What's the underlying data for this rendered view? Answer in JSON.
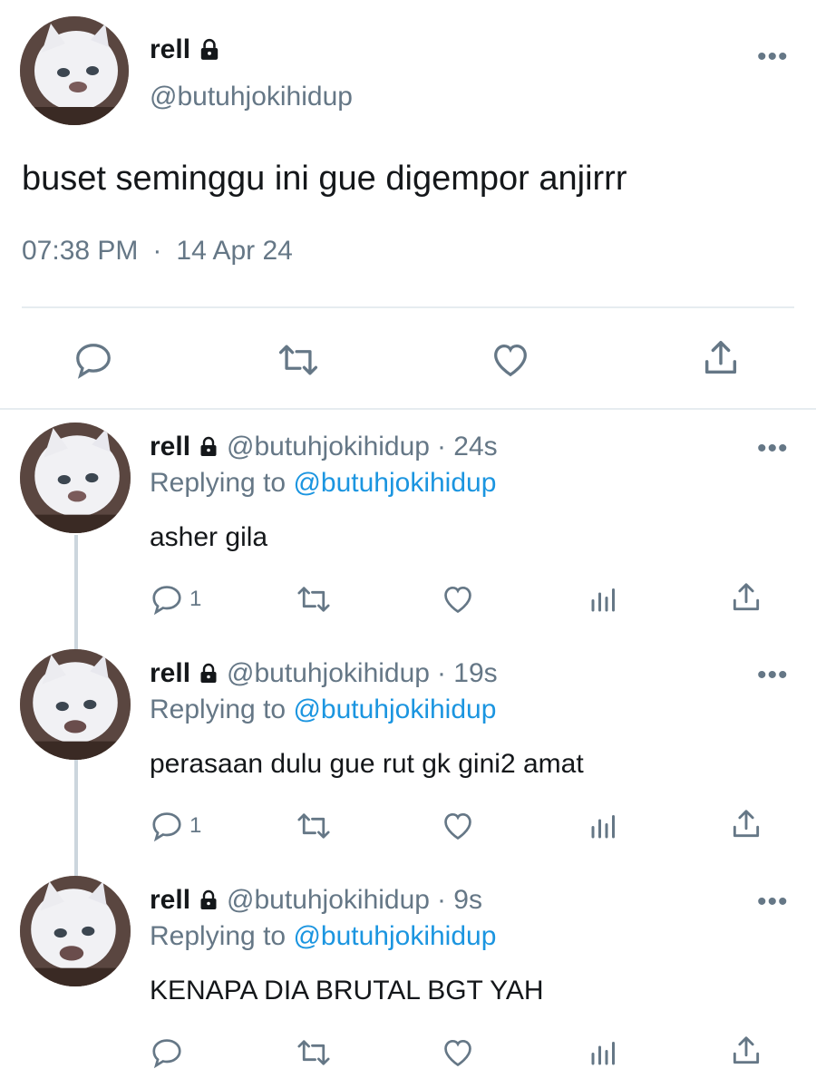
{
  "main_tweet": {
    "name": "rell",
    "handle": "@butuhjokihidup",
    "text": "buset seminggu ini gue digempor anjirrr",
    "time": "07:38 PM",
    "separator": "·",
    "date": "14 Apr 24",
    "more": "•••",
    "lock_icon": "lock-icon"
  },
  "replies": [
    {
      "name": "rell",
      "handle": "@butuhjokihidup",
      "age": "· 24s",
      "replying_prefix": "Replying to",
      "replying_to": "@butuhjokihidup",
      "text": "asher gila",
      "reply_count": "1",
      "more": "•••"
    },
    {
      "name": "rell",
      "handle": "@butuhjokihidup",
      "age": "· 19s",
      "replying_prefix": "Replying to",
      "replying_to": "@butuhjokihidup",
      "text": "perasaan dulu gue rut gk gini2 amat",
      "reply_count": "1",
      "more": "•••"
    },
    {
      "name": "rell",
      "handle": "@butuhjokihidup",
      "age": "· 9s",
      "replying_prefix": "Replying to",
      "replying_to": "@butuhjokihidup",
      "text": "KENAPA DIA BRUTAL BGT YAH",
      "reply_count": "",
      "more": "•••"
    }
  ],
  "colors": {
    "text": "#14171a",
    "muted": "#657786",
    "link": "#1b95e0",
    "divider": "#e6ecf0"
  }
}
